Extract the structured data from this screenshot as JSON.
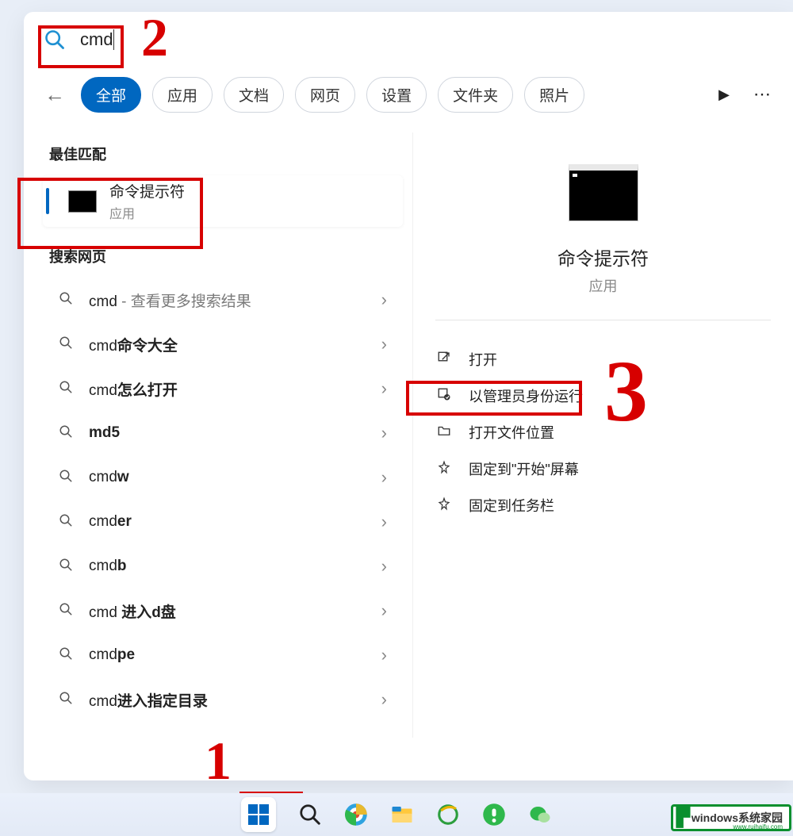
{
  "search": {
    "query": "cmd"
  },
  "tabs": {
    "items": [
      "全部",
      "应用",
      "文档",
      "网页",
      "设置",
      "文件夹",
      "照片"
    ],
    "active_index": 0
  },
  "best_match": {
    "section_label": "最佳匹配",
    "title": "命令提示符",
    "subtitle": "应用"
  },
  "web_search": {
    "section_label": "搜索网页",
    "items": [
      {
        "prefix": "cmd",
        "bold_suffix": "",
        "gray_suffix": " - 查看更多搜索结果"
      },
      {
        "prefix": "cmd",
        "bold_suffix": "命令大全",
        "gray_suffix": ""
      },
      {
        "prefix": "cmd",
        "bold_suffix": "怎么打开",
        "gray_suffix": ""
      },
      {
        "prefix": "",
        "bold_suffix": "md5",
        "gray_suffix": ""
      },
      {
        "prefix": "cmd",
        "bold_suffix": "w",
        "gray_suffix": ""
      },
      {
        "prefix": "cmd",
        "bold_suffix": "er",
        "gray_suffix": ""
      },
      {
        "prefix": "cmd",
        "bold_suffix": "b",
        "gray_suffix": ""
      },
      {
        "prefix": "cmd ",
        "bold_suffix": "进入d盘",
        "gray_suffix": ""
      },
      {
        "prefix": "cmd",
        "bold_suffix": "pe",
        "gray_suffix": ""
      },
      {
        "prefix": "cmd",
        "bold_suffix": "进入指定目录",
        "gray_suffix": ""
      }
    ]
  },
  "preview": {
    "title": "命令提示符",
    "subtitle": "应用",
    "actions": [
      {
        "icon": "open",
        "label": "打开"
      },
      {
        "icon": "admin",
        "label": "以管理员身份运行"
      },
      {
        "icon": "folder",
        "label": "打开文件位置"
      },
      {
        "icon": "pin",
        "label": "固定到\"开始\"屏幕"
      },
      {
        "icon": "pin",
        "label": "固定到任务栏"
      }
    ]
  },
  "annotations": {
    "label_1": "1",
    "label_2": "2",
    "label_3": "3"
  },
  "watermark": {
    "text": "windows系统家园",
    "sub": "www.ruihaifu.com"
  },
  "taskbar": {
    "items": [
      "start",
      "search",
      "edge",
      "explorer",
      "ie",
      "360",
      "wechat"
    ]
  }
}
